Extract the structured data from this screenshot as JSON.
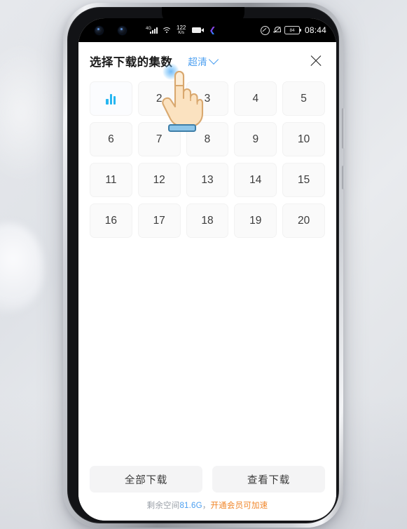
{
  "status_bar": {
    "network_type": "4G",
    "net_speed_value": "122",
    "net_speed_unit": "K/s",
    "battery_level": "84",
    "time": "08:44",
    "icons": [
      "camera-punch-hole",
      "signal-bars-icon",
      "wifi-icon",
      "network-speed",
      "screen-record-icon",
      "app-badge-icon",
      "do-not-disturb-icon",
      "mute-bell-icon",
      "battery-icon"
    ]
  },
  "header": {
    "title": "选择下载的集数",
    "quality_label": "超清",
    "quality_icon": "chevron-down-icon",
    "close_icon": "close-icon"
  },
  "episodes": [
    {
      "label": "1",
      "state": "playing",
      "icon": "equalizer-playing-icon"
    },
    {
      "label": "2",
      "state": "default",
      "icon": ""
    },
    {
      "label": "3",
      "state": "default",
      "icon": ""
    },
    {
      "label": "4",
      "state": "default",
      "icon": ""
    },
    {
      "label": "5",
      "state": "default",
      "icon": ""
    },
    {
      "label": "6",
      "state": "default",
      "icon": ""
    },
    {
      "label": "7",
      "state": "default",
      "icon": ""
    },
    {
      "label": "8",
      "state": "default",
      "icon": ""
    },
    {
      "label": "9",
      "state": "default",
      "icon": ""
    },
    {
      "label": "10",
      "state": "default",
      "icon": ""
    },
    {
      "label": "11",
      "state": "default",
      "icon": ""
    },
    {
      "label": "12",
      "state": "default",
      "icon": ""
    },
    {
      "label": "13",
      "state": "default",
      "icon": ""
    },
    {
      "label": "14",
      "state": "default",
      "icon": ""
    },
    {
      "label": "15",
      "state": "default",
      "icon": ""
    },
    {
      "label": "16",
      "state": "default",
      "icon": ""
    },
    {
      "label": "17",
      "state": "default",
      "icon": ""
    },
    {
      "label": "18",
      "state": "default",
      "icon": ""
    },
    {
      "label": "19",
      "state": "default",
      "icon": ""
    },
    {
      "label": "20",
      "state": "default",
      "icon": ""
    }
  ],
  "footer": {
    "download_all_label": "全部下载",
    "view_downloads_label": "查看下载",
    "storage_prefix": "剩余空间",
    "storage_value": "81.6G",
    "storage_suffix": "，",
    "vip_promo": "开通会员可加速"
  },
  "cursor": {
    "type": "pointing-hand-cursor",
    "target_episode": "2"
  },
  "colors": {
    "accent_blue": "#4a9ef0",
    "equalizer_blue": "#27b6f0",
    "vip_orange": "#f0862a",
    "cell_bg": "#fafafa",
    "button_bg": "#f4f4f5"
  }
}
